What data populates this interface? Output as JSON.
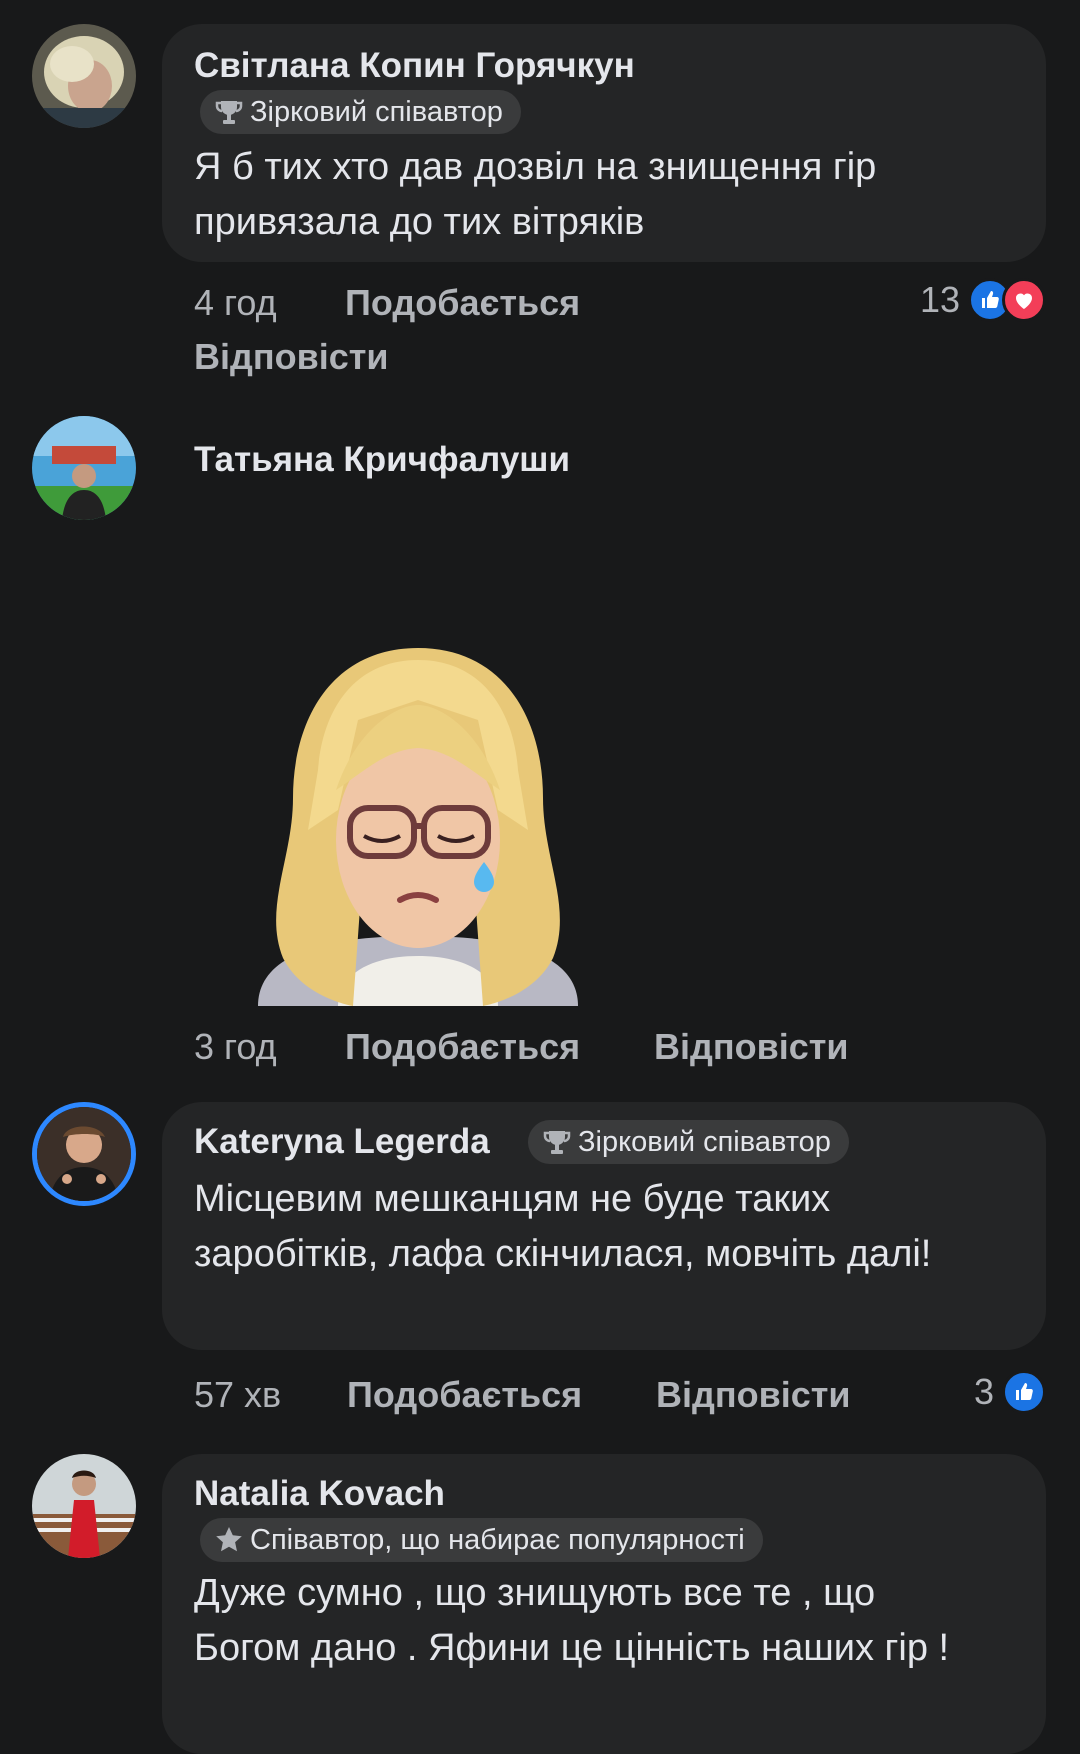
{
  "comments": [
    {
      "author": "Світлана Копин Горячкун",
      "badge": "Зірковий співавтор",
      "badge_icon": "trophy-icon",
      "text": "Я б тих хто дав дозвіл на знищення гір привязала до тих вітряків",
      "time": "4 год",
      "like_label": "Подобається",
      "reply_label": "Відповісти",
      "reaction_count": "13",
      "reactions": [
        "like-icon",
        "love-icon"
      ]
    },
    {
      "author": "Татьяна Кричфалуши",
      "sticker": "crying-girl-sticker",
      "time": "3 год",
      "like_label": "Подобається",
      "reply_label": "Відповісти"
    },
    {
      "author": "Kateryna Legerda",
      "badge": "Зірковий співавтор",
      "badge_icon": "trophy-icon",
      "text": "Місцевим мешканцям не буде таких заробітків, лафа скінчилася, мовчіть далі!",
      "time": "57 хв",
      "like_label": "Подобається",
      "reply_label": "Відповісти",
      "reaction_count": "3",
      "reactions": [
        "like-icon"
      ]
    },
    {
      "author": "Natalia Kovach",
      "badge": "Співавтор, що набирає популярності",
      "badge_icon": "star-icon",
      "text": "Дуже сумно , що знищують все те , що Богом дано . Яфини це цінність наших гір !"
    }
  ],
  "colors": {
    "background": "#18191a",
    "bubble": "#242526",
    "badge": "#3a3b3c",
    "text": "#e4e6eb",
    "secondary_text": "#b0b3b8",
    "like": "#1b74e4",
    "love": "#f33e58"
  }
}
